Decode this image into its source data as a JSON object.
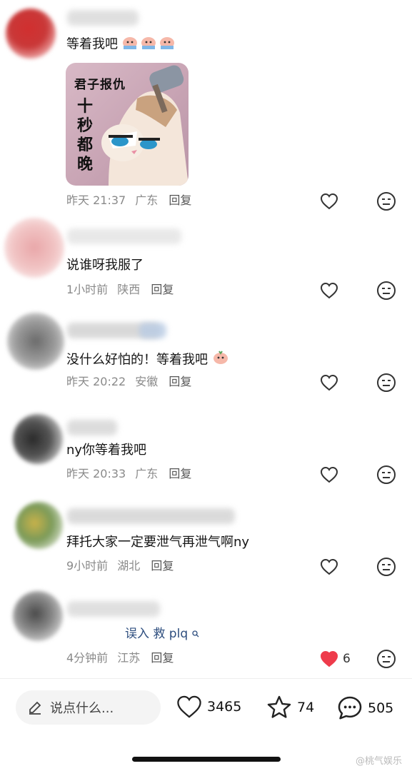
{
  "comments": [
    {
      "text": "等着我吧",
      "has_sticker": true,
      "sticker": {
        "caption": "君子报仇",
        "vertical_text": "十秒都晚"
      },
      "time": "昨天 21:37",
      "location": "广东",
      "reply_label": "回复",
      "liked": false
    },
    {
      "text": "说谁呀我服了",
      "time": "1小时前",
      "location": "陕西",
      "reply_label": "回复",
      "liked": false
    },
    {
      "text": "没什么好怕的！等着我吧",
      "time": "昨天 20:22",
      "location": "安徽",
      "reply_label": "回复",
      "liked": false
    },
    {
      "text": "ny你等着我吧",
      "time": "昨天 20:33",
      "location": "广东",
      "reply_label": "回复",
      "liked": false
    },
    {
      "text": "拜托大家一定要泄气再泄气啊ny",
      "time": "9小时前",
      "location": "湖北",
      "reply_label": "回复",
      "liked": false
    },
    {
      "text": "误入 救 plq",
      "time": "4分钟前",
      "location": "江苏",
      "reply_label": "回复",
      "liked": true,
      "like_count": "6"
    }
  ],
  "bottom_bar": {
    "input_placeholder": "说点什么...",
    "likes": "3465",
    "favorites": "74",
    "comments": "505"
  },
  "watermark": "@桃气娱乐",
  "colors": {
    "liked_heart": "#ee3b4b",
    "meta_text": "#8a8a8a",
    "link_text": "#2d4d7e"
  }
}
